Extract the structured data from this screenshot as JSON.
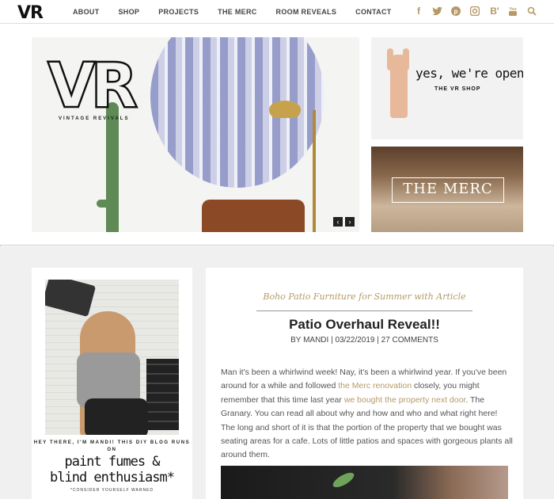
{
  "header": {
    "logo": "VR",
    "nav": [
      {
        "label": "ABOUT"
      },
      {
        "label": "SHOP"
      },
      {
        "label": "PROJECTS"
      },
      {
        "label": "THE MERC"
      },
      {
        "label": "ROOM REVEALS"
      },
      {
        "label": "CONTACT"
      }
    ],
    "social_icons": [
      "facebook-icon",
      "twitter-icon",
      "pinterest-icon",
      "instagram-icon",
      "bloglovin-icon",
      "youtube-icon",
      "search-icon"
    ],
    "accent_color": "#b59a66"
  },
  "hero": {
    "slide": {
      "logo_letters": "VR",
      "logo_subtitle": "VINTAGE REVIVALS",
      "prev_arrow": "‹",
      "next_arrow": "›"
    },
    "promo_open": {
      "headline": "yes, we're open.",
      "tagline": "THE VR SHOP"
    },
    "promo_merc": {
      "label": "THE MERC"
    }
  },
  "sidebar": {
    "intro": "HEY THERE, I'M MANDI! THIS DIY BLOG RUNS ON",
    "tagline_line1": "paint fumes &",
    "tagline_line2": "blind enthusiasm*",
    "footnote": "*CONSIDER YOURSELF WARNED"
  },
  "post": {
    "category": "Boho Patio Furniture for Summer with Article",
    "title": "Patio Overhaul Reveal!!",
    "meta": "BY MANDI | 03/22/2019 | 27 COMMENTS",
    "body_part1": "Man it's been a whirlwind week! Nay, it's been a whirlwind year. If you've been around for a while and followed ",
    "link1": "the Merc renovation",
    "body_part2": " closely, you might remember that this time last year ",
    "link2": "we bought the property next door",
    "body_part3": ". The Granary. You can read all about why and how and who and what right here! The long and short of it is that the portion of the property that we bought was seating areas for a cafe. Lots of little patios and spaces with gorgeous plants all around them."
  }
}
